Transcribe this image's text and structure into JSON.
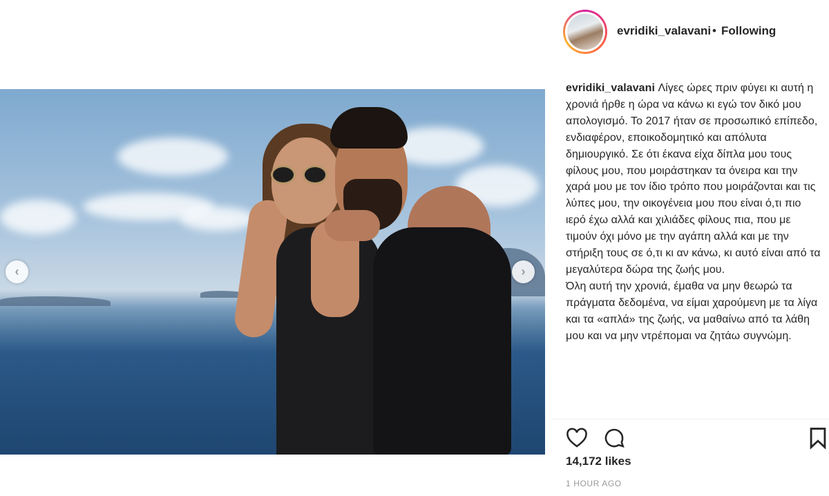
{
  "post": {
    "header": {
      "username": "evridiki_valavani",
      "separator": "•",
      "follow_status": "Following"
    },
    "caption": {
      "username": "evridiki_valavani",
      "text_1": "Λίγες ώρες πριν φύγει κι αυτή η χρονιά ήρθε η ώρα να κάνω κι εγώ τον δικό μου απολογισμό. Το 2017 ήταν σε προσωπικό επίπεδο, ενδιαφέρον, εποικοδομητικό και απόλυτα δημιουργικό. Σε ότι έκανα είχα δίπλα μου τους φίλους μου, που μοιράστηκαν τα όνειρα και την χαρά μου με τον ίδιο τρόπο που μοιράζονται και τις λύπες μου, την οικογένεια μου που είναι ό,τι πιο ιερό έχω αλλά και χιλιάδες φίλους πια, που με τιμούν όχι μόνο με την αγάπη αλλά και με την στήριξη τους σε ό,τι κι αν κάνω, κι αυτό είναι από τα μεγαλύτερα δώρα της ζωής μου.",
      "text_2": "Όλη αυτή την χρονιά, έμαθα να μην θεωρώ τα πράγματα δεδομένα, να είμαι χαρούμενη με τα λίγα και τα «απλά» της ζωής, να μαθαίνω από τα λάθη μου και να μην ντρέπομαι να ζητάω συγνώμη."
    },
    "likes": "14,172 likes",
    "timestamp": "1 HOUR AGO"
  },
  "icons": {
    "like": "heart-icon",
    "comment": "comment-icon",
    "save": "bookmark-icon",
    "prev": "chevron-left-icon",
    "next": "chevron-right-icon"
  },
  "colors": {
    "text": "#262626",
    "muted": "#999999",
    "ring_start": "#d6249f",
    "ring_end": "#fdb32e"
  }
}
